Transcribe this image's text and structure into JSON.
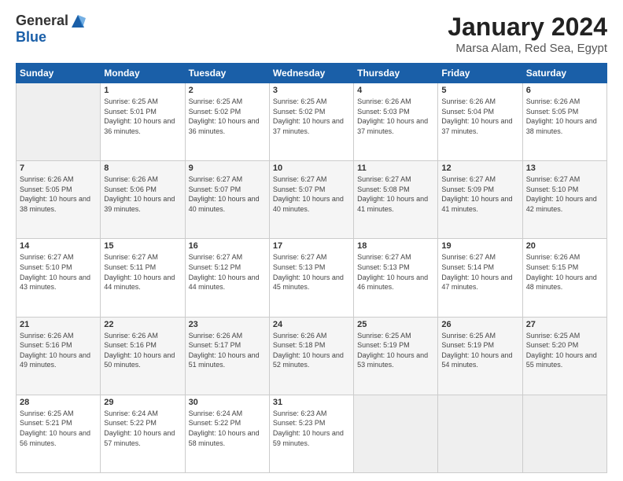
{
  "logo": {
    "general": "General",
    "blue": "Blue"
  },
  "title": "January 2024",
  "subtitle": "Marsa Alam, Red Sea, Egypt",
  "headers": [
    "Sunday",
    "Monday",
    "Tuesday",
    "Wednesday",
    "Thursday",
    "Friday",
    "Saturday"
  ],
  "weeks": [
    [
      {
        "day": "",
        "sunrise": "",
        "sunset": "",
        "daylight": ""
      },
      {
        "day": "1",
        "sunrise": "Sunrise: 6:25 AM",
        "sunset": "Sunset: 5:01 PM",
        "daylight": "Daylight: 10 hours and 36 minutes."
      },
      {
        "day": "2",
        "sunrise": "Sunrise: 6:25 AM",
        "sunset": "Sunset: 5:02 PM",
        "daylight": "Daylight: 10 hours and 36 minutes."
      },
      {
        "day": "3",
        "sunrise": "Sunrise: 6:25 AM",
        "sunset": "Sunset: 5:02 PM",
        "daylight": "Daylight: 10 hours and 37 minutes."
      },
      {
        "day": "4",
        "sunrise": "Sunrise: 6:26 AM",
        "sunset": "Sunset: 5:03 PM",
        "daylight": "Daylight: 10 hours and 37 minutes."
      },
      {
        "day": "5",
        "sunrise": "Sunrise: 6:26 AM",
        "sunset": "Sunset: 5:04 PM",
        "daylight": "Daylight: 10 hours and 37 minutes."
      },
      {
        "day": "6",
        "sunrise": "Sunrise: 6:26 AM",
        "sunset": "Sunset: 5:05 PM",
        "daylight": "Daylight: 10 hours and 38 minutes."
      }
    ],
    [
      {
        "day": "7",
        "sunrise": "Sunrise: 6:26 AM",
        "sunset": "Sunset: 5:05 PM",
        "daylight": "Daylight: 10 hours and 38 minutes."
      },
      {
        "day": "8",
        "sunrise": "Sunrise: 6:26 AM",
        "sunset": "Sunset: 5:06 PM",
        "daylight": "Daylight: 10 hours and 39 minutes."
      },
      {
        "day": "9",
        "sunrise": "Sunrise: 6:27 AM",
        "sunset": "Sunset: 5:07 PM",
        "daylight": "Daylight: 10 hours and 40 minutes."
      },
      {
        "day": "10",
        "sunrise": "Sunrise: 6:27 AM",
        "sunset": "Sunset: 5:07 PM",
        "daylight": "Daylight: 10 hours and 40 minutes."
      },
      {
        "day": "11",
        "sunrise": "Sunrise: 6:27 AM",
        "sunset": "Sunset: 5:08 PM",
        "daylight": "Daylight: 10 hours and 41 minutes."
      },
      {
        "day": "12",
        "sunrise": "Sunrise: 6:27 AM",
        "sunset": "Sunset: 5:09 PM",
        "daylight": "Daylight: 10 hours and 41 minutes."
      },
      {
        "day": "13",
        "sunrise": "Sunrise: 6:27 AM",
        "sunset": "Sunset: 5:10 PM",
        "daylight": "Daylight: 10 hours and 42 minutes."
      }
    ],
    [
      {
        "day": "14",
        "sunrise": "Sunrise: 6:27 AM",
        "sunset": "Sunset: 5:10 PM",
        "daylight": "Daylight: 10 hours and 43 minutes."
      },
      {
        "day": "15",
        "sunrise": "Sunrise: 6:27 AM",
        "sunset": "Sunset: 5:11 PM",
        "daylight": "Daylight: 10 hours and 44 minutes."
      },
      {
        "day": "16",
        "sunrise": "Sunrise: 6:27 AM",
        "sunset": "Sunset: 5:12 PM",
        "daylight": "Daylight: 10 hours and 44 minutes."
      },
      {
        "day": "17",
        "sunrise": "Sunrise: 6:27 AM",
        "sunset": "Sunset: 5:13 PM",
        "daylight": "Daylight: 10 hours and 45 minutes."
      },
      {
        "day": "18",
        "sunrise": "Sunrise: 6:27 AM",
        "sunset": "Sunset: 5:13 PM",
        "daylight": "Daylight: 10 hours and 46 minutes."
      },
      {
        "day": "19",
        "sunrise": "Sunrise: 6:27 AM",
        "sunset": "Sunset: 5:14 PM",
        "daylight": "Daylight: 10 hours and 47 minutes."
      },
      {
        "day": "20",
        "sunrise": "Sunrise: 6:26 AM",
        "sunset": "Sunset: 5:15 PM",
        "daylight": "Daylight: 10 hours and 48 minutes."
      }
    ],
    [
      {
        "day": "21",
        "sunrise": "Sunrise: 6:26 AM",
        "sunset": "Sunset: 5:16 PM",
        "daylight": "Daylight: 10 hours and 49 minutes."
      },
      {
        "day": "22",
        "sunrise": "Sunrise: 6:26 AM",
        "sunset": "Sunset: 5:16 PM",
        "daylight": "Daylight: 10 hours and 50 minutes."
      },
      {
        "day": "23",
        "sunrise": "Sunrise: 6:26 AM",
        "sunset": "Sunset: 5:17 PM",
        "daylight": "Daylight: 10 hours and 51 minutes."
      },
      {
        "day": "24",
        "sunrise": "Sunrise: 6:26 AM",
        "sunset": "Sunset: 5:18 PM",
        "daylight": "Daylight: 10 hours and 52 minutes."
      },
      {
        "day": "25",
        "sunrise": "Sunrise: 6:25 AM",
        "sunset": "Sunset: 5:19 PM",
        "daylight": "Daylight: 10 hours and 53 minutes."
      },
      {
        "day": "26",
        "sunrise": "Sunrise: 6:25 AM",
        "sunset": "Sunset: 5:19 PM",
        "daylight": "Daylight: 10 hours and 54 minutes."
      },
      {
        "day": "27",
        "sunrise": "Sunrise: 6:25 AM",
        "sunset": "Sunset: 5:20 PM",
        "daylight": "Daylight: 10 hours and 55 minutes."
      }
    ],
    [
      {
        "day": "28",
        "sunrise": "Sunrise: 6:25 AM",
        "sunset": "Sunset: 5:21 PM",
        "daylight": "Daylight: 10 hours and 56 minutes."
      },
      {
        "day": "29",
        "sunrise": "Sunrise: 6:24 AM",
        "sunset": "Sunset: 5:22 PM",
        "daylight": "Daylight: 10 hours and 57 minutes."
      },
      {
        "day": "30",
        "sunrise": "Sunrise: 6:24 AM",
        "sunset": "Sunset: 5:22 PM",
        "daylight": "Daylight: 10 hours and 58 minutes."
      },
      {
        "day": "31",
        "sunrise": "Sunrise: 6:23 AM",
        "sunset": "Sunset: 5:23 PM",
        "daylight": "Daylight: 10 hours and 59 minutes."
      },
      {
        "day": "",
        "sunrise": "",
        "sunset": "",
        "daylight": ""
      },
      {
        "day": "",
        "sunrise": "",
        "sunset": "",
        "daylight": ""
      },
      {
        "day": "",
        "sunrise": "",
        "sunset": "",
        "daylight": ""
      }
    ]
  ]
}
